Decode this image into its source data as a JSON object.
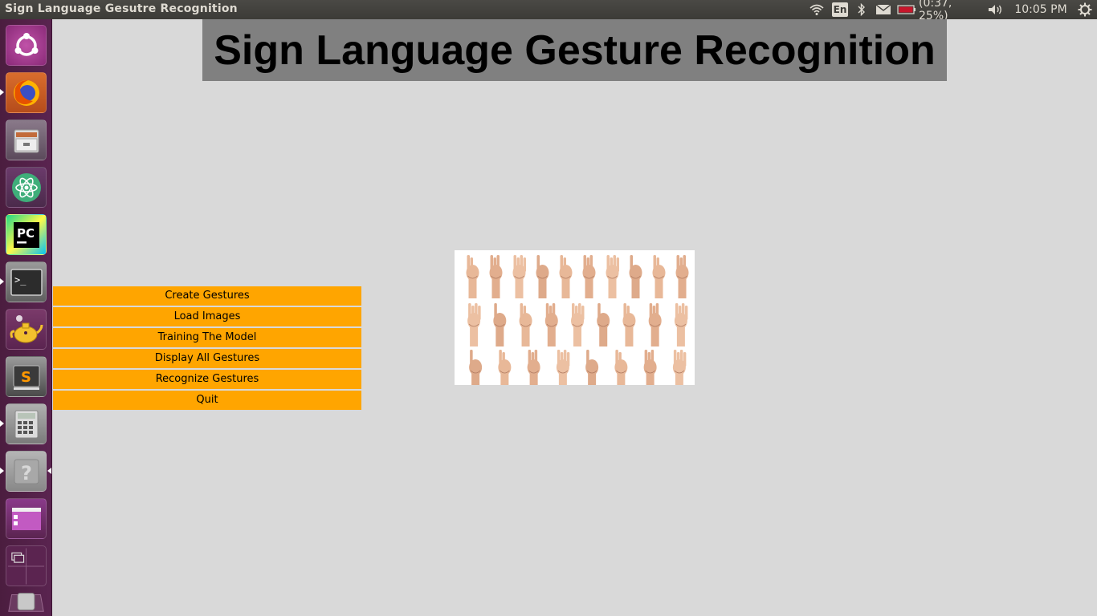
{
  "window_title": "Sign Language Gesutre Recognition",
  "tray": {
    "wifi_icon": "wifi-icon",
    "keyboard_layout": "En",
    "bluetooth_icon": "bluetooth-icon",
    "mail_icon": "mail-icon",
    "battery_icon": "battery-icon",
    "battery_text": "(0:37, 25%)",
    "volume_icon": "volume-icon",
    "clock": "10:05 PM",
    "settings_icon": "gear-icon"
  },
  "launcher": {
    "items": [
      {
        "name": "ubuntu-dash-icon"
      },
      {
        "name": "firefox-icon"
      },
      {
        "name": "files-icon"
      },
      {
        "name": "atom-icon"
      },
      {
        "name": "pycharm-icon"
      },
      {
        "name": "terminal-icon"
      },
      {
        "name": "genie-teapot-icon"
      },
      {
        "name": "sublime-text-icon"
      },
      {
        "name": "calculator-icon"
      },
      {
        "name": "help-icon"
      },
      {
        "name": "app-window-icon"
      },
      {
        "name": "workspace-switcher-icon"
      },
      {
        "name": "trash-icon"
      }
    ]
  },
  "app": {
    "heading": "Sign Language Gesture Recognition",
    "menu": [
      "Create Gestures",
      "Load Images",
      "Training The Model",
      "Display All Gestures",
      "Recognize Gestures",
      "Quit"
    ],
    "image_icon": "sign-language-alphabet-image"
  },
  "colors": {
    "button_bg": "#ffa500",
    "heading_bg": "#808080",
    "window_bg": "#d9d9d9",
    "launcher_bg": "#5a2450",
    "panel_bg": "#3c3b37"
  }
}
